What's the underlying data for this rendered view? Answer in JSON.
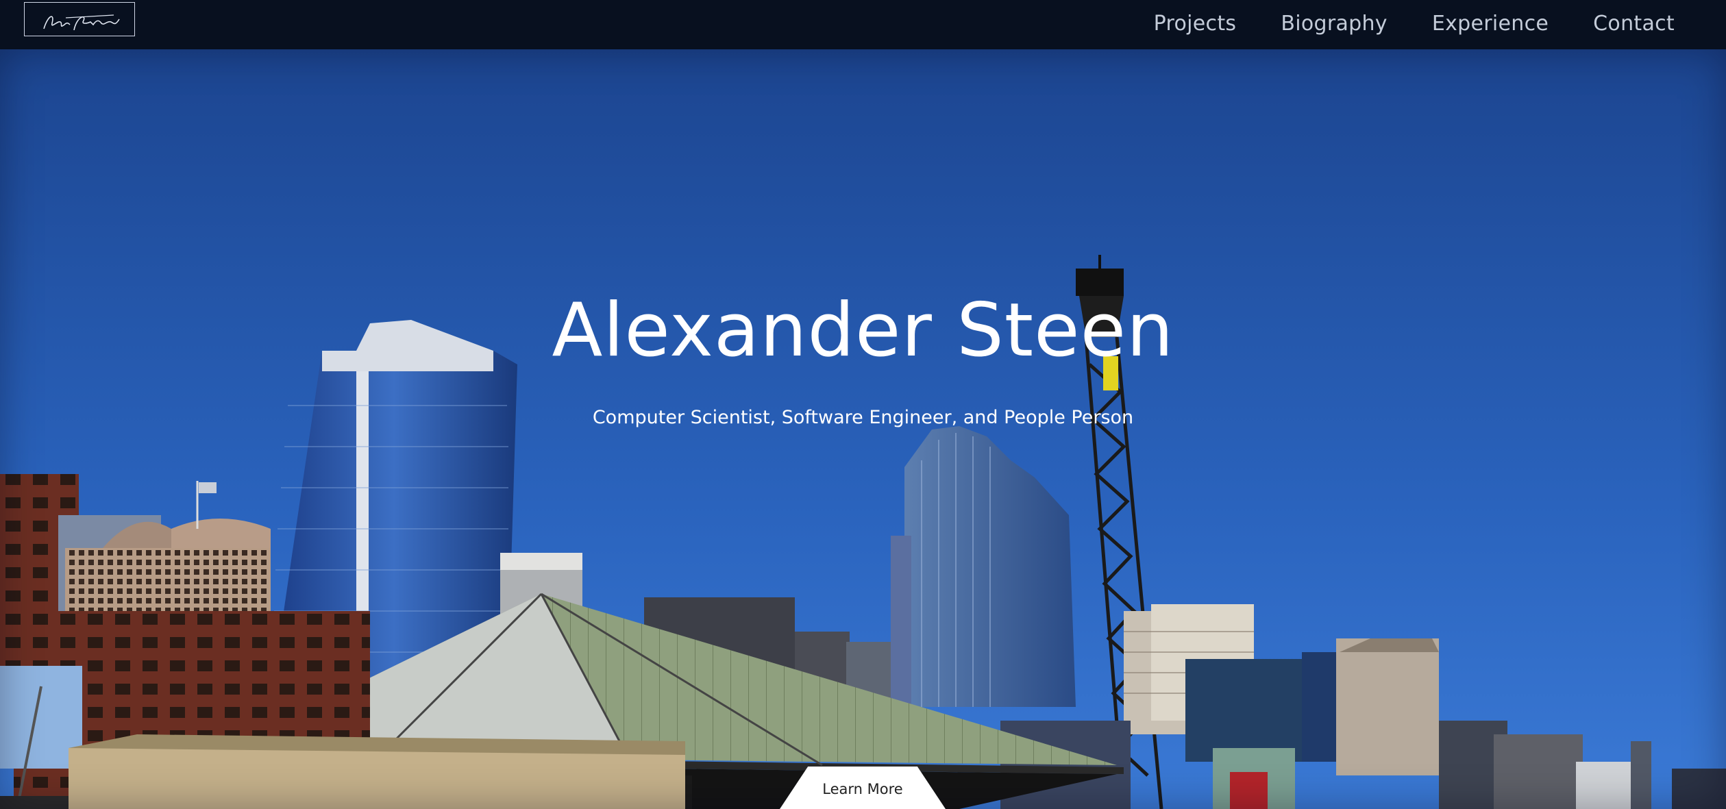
{
  "nav": {
    "logo_alt": "Alex Steen signature",
    "links": [
      "Projects",
      "Biography",
      "Experience",
      "Contact"
    ]
  },
  "hero": {
    "title": "Alexander Steen",
    "subtitle": "Computer Scientist, Software Engineer, and People Person",
    "cta_label": "Learn More"
  },
  "colors": {
    "nav_bg": "#08101f",
    "sky_top": "#1f4b96",
    "sky_bottom": "#2f6dc8",
    "text": "#ffffff"
  }
}
